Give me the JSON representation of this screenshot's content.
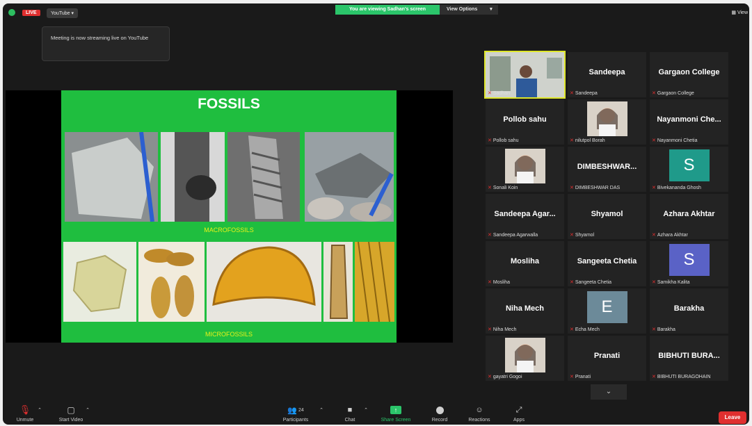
{
  "topbar": {
    "live_badge": "LIVE",
    "stream_button": "YouTube",
    "viewing_banner": "You are viewing Sadhan's screen",
    "view_options": "View Options",
    "view_button": "View"
  },
  "tooltip": {
    "text": "Meeting is now streaming live on YouTube"
  },
  "slide": {
    "title": "FOSSILS",
    "macro_label": "MACROFOSSILS",
    "micro_label": "MICROFOSSILS"
  },
  "gallery": {
    "tiles": [
      {
        "display": "",
        "label": "Sadhan",
        "type": "video"
      },
      {
        "display": "Sandeepa",
        "label": "Sandeepa",
        "type": "name"
      },
      {
        "display": "Gargaon College",
        "label": "Gargaon College",
        "type": "name"
      },
      {
        "display": "Pollob sahu",
        "label": "Pollob sahu",
        "type": "name"
      },
      {
        "display": "",
        "label": "nilutpol Borah",
        "type": "photo"
      },
      {
        "display": "Nayanmoni Che...",
        "label": "Nayanmoni Chetia",
        "type": "name"
      },
      {
        "display": "",
        "label": "Sonali Koin",
        "type": "photo"
      },
      {
        "display": "DIMBESHWAR...",
        "label": "DIMBESHWAR DAS",
        "type": "name"
      },
      {
        "display": "S",
        "label": "Bivekananda Ghosh",
        "type": "letter",
        "color": "#1f9a8a"
      },
      {
        "display": "Sandeepa Agar...",
        "label": "Sandeepa Agarwalla",
        "type": "name"
      },
      {
        "display": "Shyamol",
        "label": "Shyamol",
        "type": "name"
      },
      {
        "display": "Azhara Akhtar",
        "label": "Azhara Akhtar",
        "type": "name"
      },
      {
        "display": "Mosliha",
        "label": "Mosliha",
        "type": "name"
      },
      {
        "display": "Sangeeta Chetia",
        "label": "Sangeeta Chetia",
        "type": "name"
      },
      {
        "display": "S",
        "label": "Samikha Kalita",
        "type": "letter",
        "color": "#5a62c6"
      },
      {
        "display": "Niha Mech",
        "label": "Niha Mech",
        "type": "name"
      },
      {
        "display": "E",
        "label": "Echa Mech",
        "type": "letter",
        "color": "#6c8a99"
      },
      {
        "display": "Barakha",
        "label": "Barakha",
        "type": "name"
      },
      {
        "display": "",
        "label": "gayatri Gogoi",
        "type": "photo"
      },
      {
        "display": "Pranati",
        "label": "Pranati",
        "type": "name"
      },
      {
        "display": "BIBHUTI BURA...",
        "label": "BIBHUTI BURAGOHAIN",
        "type": "name"
      }
    ]
  },
  "toolbar": {
    "unmute": "Unmute",
    "start_video": "Start Video",
    "participants": "Participants",
    "participant_count": "24",
    "chat": "Chat",
    "share_screen": "Share Screen",
    "record": "Record",
    "reactions": "Reactions",
    "apps": "Apps",
    "leave": "Leave"
  },
  "colors": {
    "accent_green": "#2bc56a",
    "live_red": "#e02f2f",
    "slide_green": "#1fbe3f",
    "active_speaker": "#dfe62a"
  }
}
